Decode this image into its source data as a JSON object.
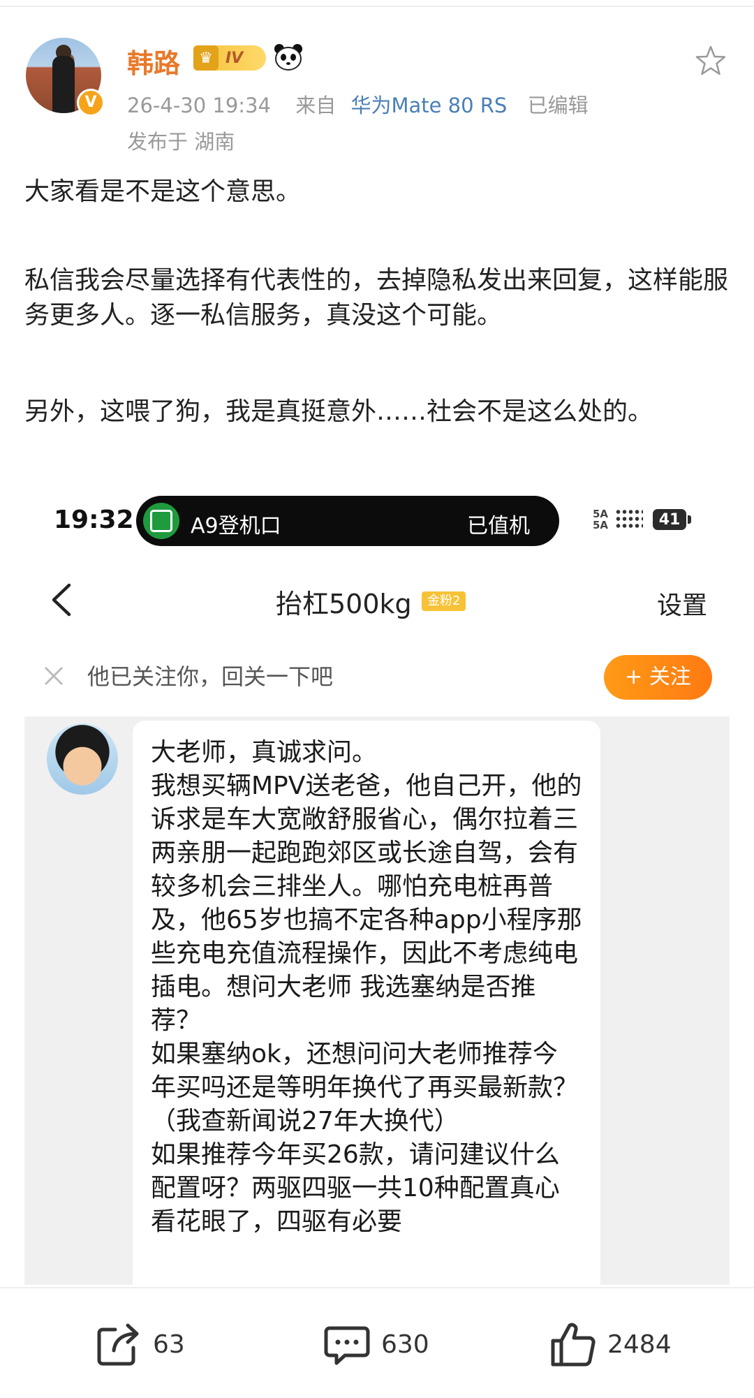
{
  "post": {
    "author": "韩路",
    "level_badge": "IV",
    "time": "26-4-30 19:34",
    "from_label": "来自",
    "device": "华为Mate 80 RS",
    "edited": "已编辑",
    "location": "发布于 湖南",
    "paragraphs": [
      "大家看是不是这个意思。",
      "私信我会尽量选择有代表性的，去掉隐私发出来回复，这样能服务更多人。逐一私信服务，真没这个可能。",
      "另外，这喂了狗，我是真挺意外……社会不是这么处的。"
    ]
  },
  "screenshot": {
    "status_time": "19:32",
    "island_text": "A9登机口",
    "island_status": "已值机",
    "signal_label": "5A\n5A",
    "battery": "41",
    "chat_title": "抬杠500kg",
    "fan_badge": "金粉2",
    "settings": "设置",
    "follow_prompt": "他已关注你，回关一下吧",
    "follow_button": "+ 关注",
    "message": "大老师，真诚求问。\n我想买辆MPV送老爸，他自己开，他的诉求是车大宽敞舒服省心，偶尔拉着三两亲朋一起跑跑郊区或长途自驾，会有较多机会三排坐人。哪怕充电桩再普及，他65岁也搞不定各种app小程序那些充电充值流程操作，因此不考虑纯电插电。想问大老师 我选塞纳是否推荐？\n如果塞纳ok，还想问问大老师推荐今年买吗还是等明年换代了再买最新款？（我查新闻说27年大换代）\n如果推荐今年买26款，请问建议什么配置呀？两驱四驱一共10种配置真心看花眼了，四驱有必要"
  },
  "actions": {
    "shares": "63",
    "comments": "630",
    "likes": "2484"
  },
  "colors": {
    "username": "#e8792a",
    "device": "#4a7fb8",
    "follow_button": "#ff8a14",
    "vip_badge": "#f6a31b"
  }
}
